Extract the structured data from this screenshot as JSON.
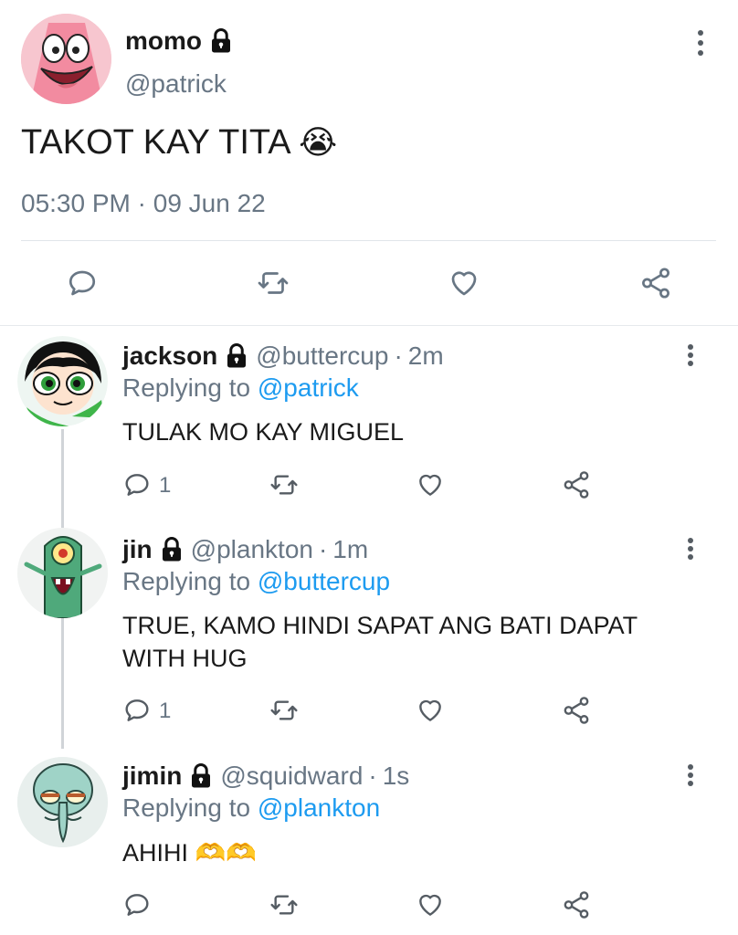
{
  "main_tweet": {
    "display_name": "momo",
    "handle": "@patrick",
    "text": "TAKOT KAY TITA",
    "emoji": "😭",
    "time": "05:30 PM",
    "separator": "·",
    "date": "09 Jun 22"
  },
  "replies": [
    {
      "display_name": "jackson",
      "handle": "@buttercup",
      "dot": "·",
      "age": "2m",
      "replying_prefix": "Replying to",
      "replying_to": "@patrick",
      "text": "TULAK MO KAY MIGUEL",
      "reply_count": "1"
    },
    {
      "display_name": "jin",
      "handle": "@plankton",
      "dot": "·",
      "age": "1m",
      "replying_prefix": "Replying to",
      "replying_to": "@buttercup",
      "text_line1": "TRUE, KAMO HINDI SAPAT ANG BATI DAPAT",
      "text_line2": "WITH HUG",
      "reply_count": "1"
    },
    {
      "display_name": "jimin",
      "handle": "@squidward",
      "dot": "·",
      "age": "1s",
      "replying_prefix": "Replying to",
      "replying_to": "@plankton",
      "text": "AHIHI",
      "emoji": "🫶🫶",
      "reply_count": ""
    }
  ],
  "icons": {
    "lock": "lock-icon",
    "more": "more-vertical-icon",
    "reply": "reply-icon",
    "retweet": "retweet-icon",
    "like": "heart-icon",
    "share": "share-icon"
  },
  "colors": {
    "link": "#1d9bf0",
    "muted": "#687684",
    "icon": "#687684"
  }
}
